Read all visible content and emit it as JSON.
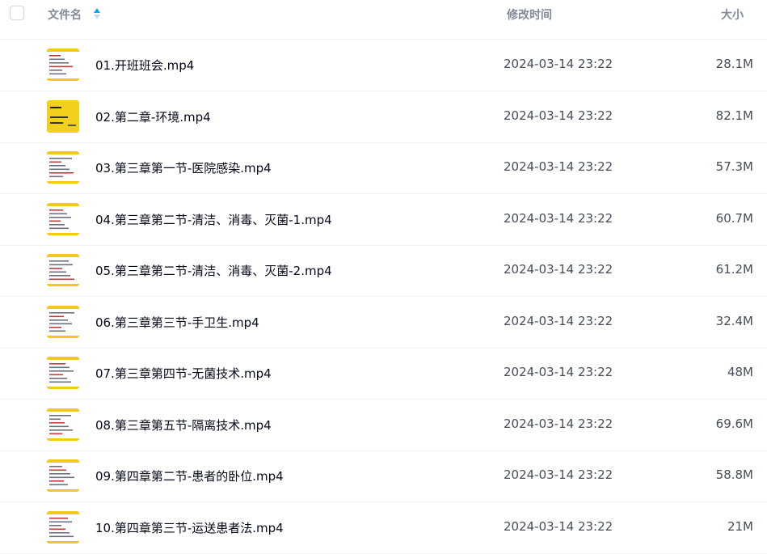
{
  "header": {
    "name_label": "文件名",
    "modified_label": "修改时间",
    "size_label": "大小"
  },
  "colors": {
    "thumb_accent": "#f2c81b",
    "sort_active": "#06a7ff",
    "sort_inactive": "#c4d8f4"
  },
  "files": [
    {
      "name": "01.开班班会.mp4",
      "modified": "2024-03-14 23:22",
      "size": "28.1M",
      "thumb": "white"
    },
    {
      "name": "02.第二章-环境.mp4",
      "modified": "2024-03-14 23:22",
      "size": "82.1M",
      "thumb": "yellow"
    },
    {
      "name": "03.第三章第一节-医院感染.mp4",
      "modified": "2024-03-14 23:22",
      "size": "57.3M",
      "thumb": "white"
    },
    {
      "name": "04.第三章第二节-清洁、消毒、灭菌-1.mp4",
      "modified": "2024-03-14 23:22",
      "size": "60.7M",
      "thumb": "white"
    },
    {
      "name": "05.第三章第二节-清洁、消毒、灭菌-2.mp4",
      "modified": "2024-03-14 23:22",
      "size": "61.2M",
      "thumb": "white"
    },
    {
      "name": "06.第三章第三节-手卫生.mp4",
      "modified": "2024-03-14 23:22",
      "size": "32.4M",
      "thumb": "white"
    },
    {
      "name": "07.第三章第四节-无菌技术.mp4",
      "modified": "2024-03-14 23:22",
      "size": "48M",
      "thumb": "white"
    },
    {
      "name": "08.第三章第五节-隔离技术.mp4",
      "modified": "2024-03-14 23:22",
      "size": "69.6M",
      "thumb": "white"
    },
    {
      "name": "09.第四章第二节-患者的卧位.mp4",
      "modified": "2024-03-14 23:22",
      "size": "58.8M",
      "thumb": "white"
    },
    {
      "name": "10.第四章第三节-运送患者法.mp4",
      "modified": "2024-03-14 23:22",
      "size": "21M",
      "thumb": "white"
    }
  ]
}
